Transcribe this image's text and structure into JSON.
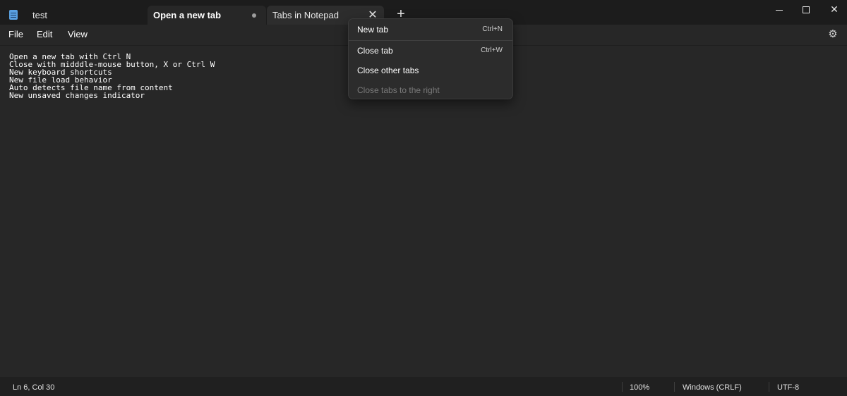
{
  "tabs": [
    {
      "title": "test"
    },
    {
      "title": "Open a new tab",
      "unsaved": true
    },
    {
      "title": "Tabs in Notepad"
    }
  ],
  "menu": {
    "file": "File",
    "edit": "Edit",
    "view": "View"
  },
  "editor": {
    "content": "Open a new tab with Ctrl N\nClose with midddle-mouse button, X or Ctrl W\nNew keyboard shortcuts\nNew file load behavior\nAuto detects file name from content\nNew unsaved changes indicator"
  },
  "context_menu": {
    "items": [
      {
        "label": "New tab",
        "shortcut": "Ctrl+N",
        "enabled": true
      },
      {
        "label": "Close tab",
        "shortcut": "Ctrl+W",
        "enabled": true
      },
      {
        "label": "Close other tabs",
        "shortcut": "",
        "enabled": true
      },
      {
        "label": "Close tabs to the right",
        "shortcut": "",
        "enabled": false
      }
    ]
  },
  "status": {
    "position": "Ln 6, Col 30",
    "zoom": "100%",
    "line_ending": "Windows (CRLF)",
    "encoding": "UTF-8"
  },
  "icons": {
    "app": "notepad-icon",
    "add_tab": "plus-icon",
    "settings": "gear-icon",
    "close_tab": "close-icon"
  },
  "colors": {
    "background": "#272727",
    "titlebar": "#1c1c1c",
    "menu": "#2c2c2c"
  }
}
